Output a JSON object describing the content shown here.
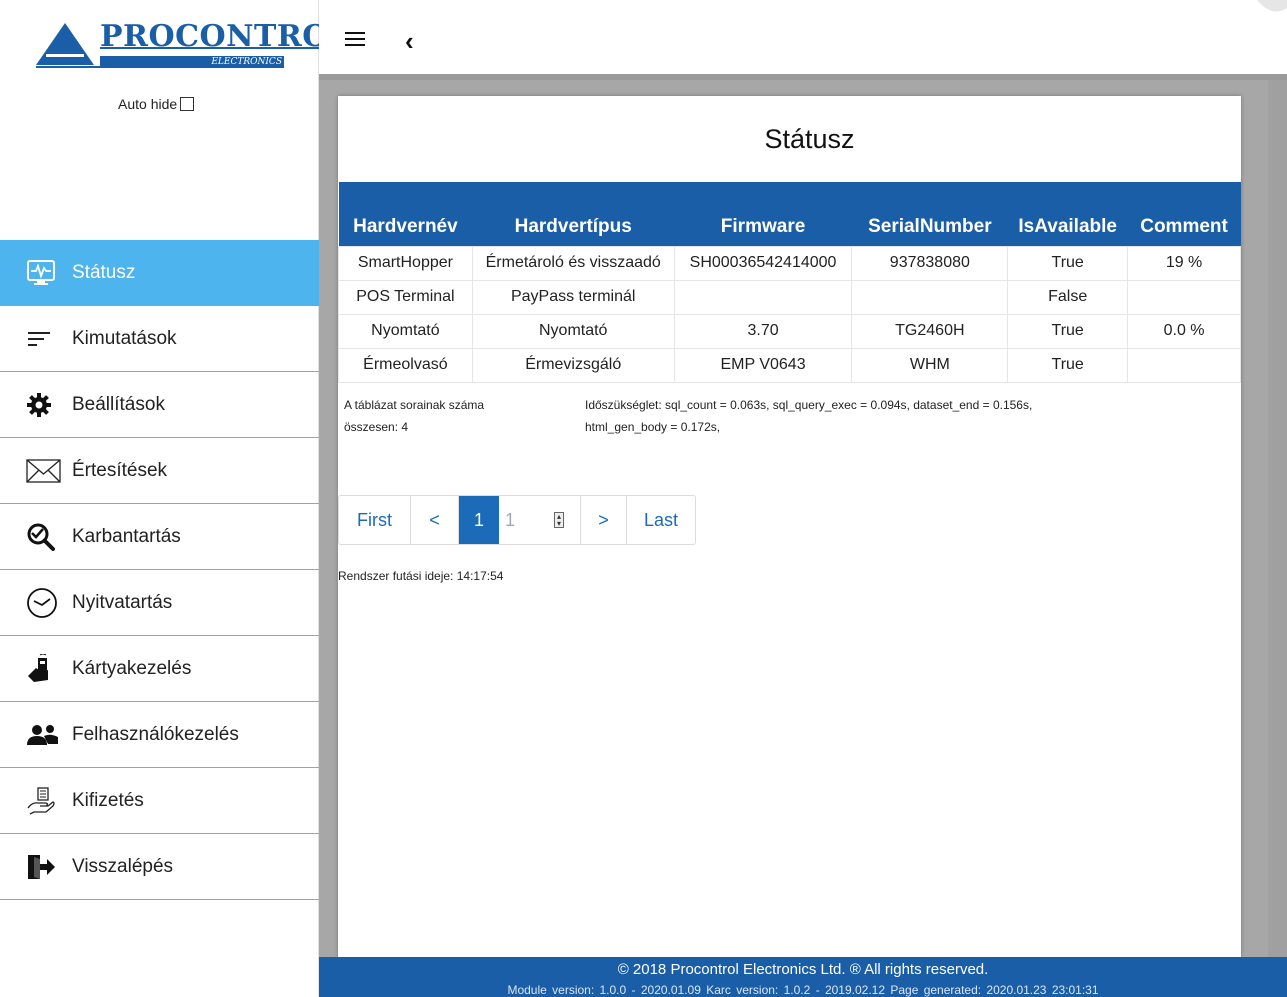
{
  "logo": {
    "brand": "PROCONTROL",
    "sub": "ELECTRONICS"
  },
  "sidebar": {
    "auto_hide_label": "Auto hide",
    "items": [
      {
        "label": "Státusz",
        "icon": "monitor-pulse-icon",
        "active": true
      },
      {
        "label": "Kimutatások",
        "icon": "list-lines-icon"
      },
      {
        "label": "Beállítások",
        "icon": "gear-icon"
      },
      {
        "label": "Értesítések",
        "icon": "envelope-icon"
      },
      {
        "label": "Karbantartás",
        "icon": "wrench-magnifier-icon"
      },
      {
        "label": "Nyitvatartás",
        "icon": "clock-icon"
      },
      {
        "label": "Kártyakezelés",
        "icon": "card-hand-icon"
      },
      {
        "label": "Felhasználókezelés",
        "icon": "users-icon"
      },
      {
        "label": "Kifizetés",
        "icon": "cash-hand-icon"
      },
      {
        "label": "Visszalépés",
        "icon": "logout-icon"
      }
    ]
  },
  "topbar": {
    "menu_icon": "hamburger-menu-icon",
    "back_icon": "chevron-left-icon",
    "back_glyph": "‹"
  },
  "main": {
    "title": "Státusz",
    "table": {
      "headers": [
        "Hardvernév",
        "Hardvertípus",
        "Firmware",
        "SerialNumber",
        "IsAvailable",
        "Comment"
      ],
      "rows": [
        [
          "SmartHopper",
          "Érmetároló és visszaadó",
          "SH00036542414000",
          "937838080",
          "True",
          "19 %"
        ],
        [
          "POS Terminal",
          "PayPass terminál",
          "",
          "",
          "False",
          ""
        ],
        [
          "Nyomtató",
          "Nyomtató",
          "3.70",
          "TG2460H",
          "True",
          "0.0 %"
        ],
        [
          "Érmeolvasó",
          "Érmevizsgáló",
          "EMP V0643",
          "WHM",
          "True",
          ""
        ]
      ]
    },
    "row_count_line1": "A táblázat sorainak száma",
    "row_count_line2": "összesen: 4",
    "timing_line1": "Időszükséglet: sql_count = 0.063s, sql_query_exec = 0.094s, dataset_end = 0.156s,",
    "timing_line2": "html_gen_body = 0.172s,",
    "pager": {
      "first": "First",
      "prev": "<",
      "current": "1",
      "page_input": "1",
      "next": ">",
      "last": "Last"
    },
    "uptime": "Rendszer futási ideje: 14:17:54"
  },
  "footer": {
    "copyright": "© 2018 Procontrol Electronics Ltd. ® All rights reserved.",
    "versions": "Module version: 1.0.0 - 2020.01.09    Karc version: 1.0.2 - 2019.02.12    Page generated: 2020.01.23 23:01:31"
  },
  "colors": {
    "brand_blue": "#1b5ea8",
    "active_nav": "#4db4ee",
    "separator": "#56b9e8"
  }
}
